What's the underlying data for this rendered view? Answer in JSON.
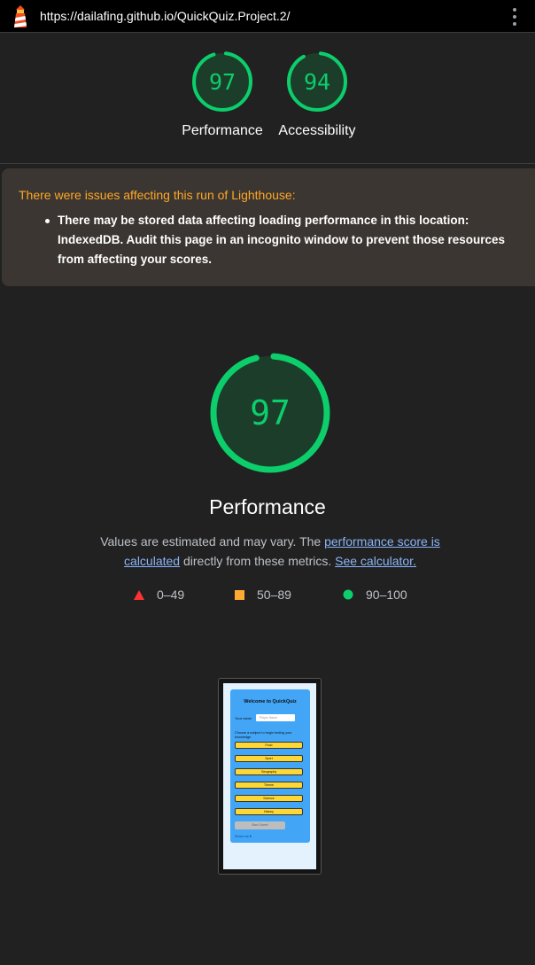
{
  "browser": {
    "url": "https://dailafing.github.io/QuickQuiz.Project.2/"
  },
  "summary": [
    {
      "score": "97",
      "label": "Performance",
      "value": 0.97
    },
    {
      "score": "94",
      "label": "Accessibility",
      "value": 0.94
    }
  ],
  "warning": {
    "title": "There were issues affecting this run of Lighthouse:",
    "items": [
      "There may be stored data affecting loading performance in this location: IndexedDB. Audit this page in an incognito window to prevent those resources from affecting your scores."
    ]
  },
  "category": {
    "score": "97",
    "value": 0.97,
    "title": "Performance",
    "desc_prefix": "Values are estimated and may vary. The ",
    "link1": "performance score is calculated",
    "desc_middle": " directly from these metrics. ",
    "link2": "See calculator."
  },
  "legend": [
    {
      "range": "0–49",
      "color": "#ff3333",
      "shape": "triangle"
    },
    {
      "range": "50–89",
      "color": "#ffaa33",
      "shape": "square"
    },
    {
      "range": "90–100",
      "color": "#0cce6b",
      "shape": "circle"
    }
  ],
  "colors": {
    "pass": "#0cce6b",
    "pass_fill": "#1d3d2b",
    "warning_text": "#ffa726",
    "background": "#212121"
  },
  "screenshot": {
    "title": "Welcome to QuickQuiz",
    "name_label": "Your name",
    "name_placeholder": "Player Name",
    "choose_text": "Choose a subject to begin testing your knowledge",
    "subjects": [
      "Food",
      "Sport",
      "Geography",
      "Theme",
      "Science",
      "History"
    ],
    "start_label": "Start Game!",
    "show_more": "Show me▼"
  }
}
